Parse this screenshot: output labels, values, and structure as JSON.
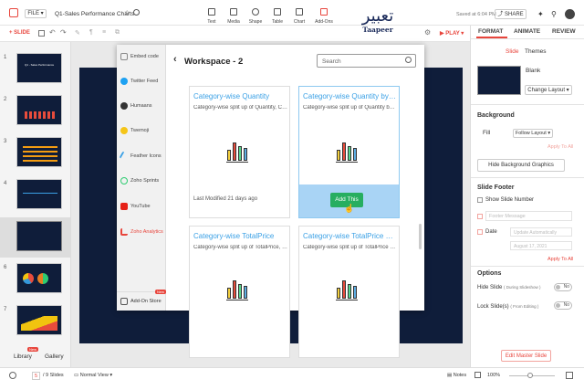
{
  "topbar": {
    "file_label": "FILE",
    "doc_title": "Q1-Sales Performance Charts",
    "saved_text": "Saved at 6:04 PM",
    "share_label": "SHARE",
    "logo_text": "تعبير",
    "logo_sub": "Taapeer",
    "tools": [
      "Text",
      "Media",
      "Shape",
      "Table",
      "Chart",
      "Add-Ons"
    ],
    "slide_label": "SLIDE",
    "play_label": "PLAY"
  },
  "right_tabs": [
    "FORMAT",
    "ANIMATE",
    "REVIEW"
  ],
  "slide_panel": {
    "subtabs": [
      "Slide",
      "Themes"
    ],
    "layout_name": "Blank",
    "change_layout": "Change Layout",
    "background_heading": "Background",
    "fill_label": "Fill",
    "fill_value": "Follow Layout",
    "apply_to_all_1": "Apply To All",
    "hide_bg_graphics": "Hide Background Graphics",
    "footer_heading": "Slide Footer",
    "show_slide_number": "Show Slide Number",
    "footer_placeholder": "Footer Message",
    "date_label": "Date",
    "date_update": "Update Automatically",
    "date_value": "August 17, 2021",
    "apply_to_all_2": "Apply To All",
    "options_heading": "Options",
    "hide_slide": "Hide Slide",
    "hide_slide_hint": "( During Slideshow )",
    "lock_slide": "Lock Slide(s)",
    "lock_slide_hint": "( From Editing )",
    "toggle_no": "No",
    "edit_master": "Edit Master Slide"
  },
  "addon_panel": {
    "items": [
      "Embed code",
      "Twitter Feed",
      "Humaans",
      "Twemoji",
      "Feather Icons",
      "Zoho Sprints",
      "YouTube",
      "Zoho Analytics"
    ],
    "addon_store": "Add-On Store",
    "new_badge": "New",
    "workspace_title": "Workspace - 2",
    "search_placeholder": "Search",
    "cards": [
      {
        "title": "Category-wise Quantity",
        "subtitle": "Category-wise split up of Quantity, Cat...",
        "footer": "Last Modified 21 days ago"
      },
      {
        "title": "Category-wise Quantity by Reg...",
        "subtitle": "Category-wise split up of Quantity by ...",
        "footer": "Add This"
      },
      {
        "title": "Category-wise TotalPrice",
        "subtitle": "Category-wise split up of TotalPrice, C..."
      },
      {
        "title": "Category-wise TotalPrice by Re...",
        "subtitle": "Category-wise split up of TotalPrice by..."
      }
    ]
  },
  "thumbnails": {
    "numbers": [
      "1",
      "2",
      "3",
      "4",
      "5",
      "6",
      "7"
    ],
    "slide1_title": "Q1 - Sales Performance"
  },
  "left_bottom": {
    "library": "Library",
    "gallery": "Gallery",
    "new_badge": "New"
  },
  "statusbar": {
    "current_slide": "5",
    "total_slides": "/ 9 Slides",
    "view": "Normal View",
    "notes": "Notes",
    "zoom": "100%"
  },
  "colors": {
    "accent": "#e8453c",
    "link": "#3aa0e5",
    "slide_bg": "#0f1d3a",
    "add_this": "#27ae60"
  }
}
